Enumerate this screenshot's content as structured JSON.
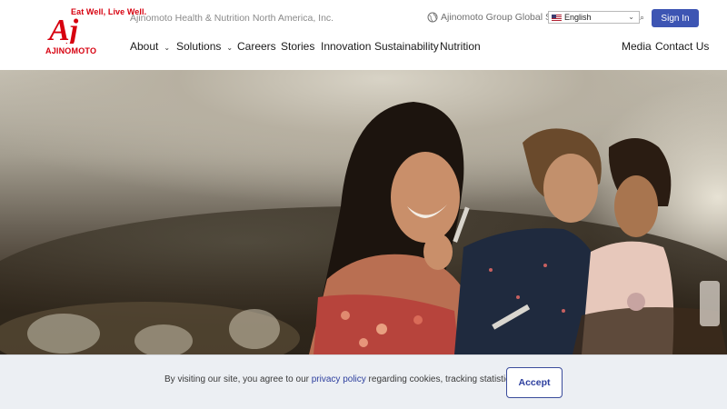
{
  "brand": {
    "tagline": "Eat Well, Live Well.",
    "wordmark": "AJINOMOTO",
    "logo_letters": "Aj",
    "brand_color": "#d7000f"
  },
  "header": {
    "company_name": "Ajinomoto Health & Nutrition North America, Inc.",
    "global_site": "Ajinomoto Group Global Site",
    "language": "English",
    "sign_in": "Sign In"
  },
  "nav": {
    "about": "About",
    "solutions": "Solutions",
    "careers": "Careers",
    "stories": "Stories",
    "innovation": "Innovation",
    "sustainability": "Sustainability",
    "nutrition": "Nutrition",
    "media": "Media",
    "contact": "Contact Us"
  },
  "cookie": {
    "before": "By visiting our site, you agree to our ",
    "link": "privacy policy",
    "after": " regarding cookies, tracking statistics, etc.",
    "accept": "Accept"
  },
  "colors": {
    "primary_button": "#3d55b3",
    "link": "#2d3f9e"
  }
}
